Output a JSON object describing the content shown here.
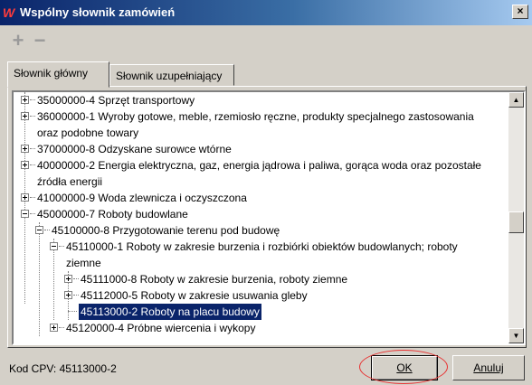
{
  "window": {
    "title": "Wspólny słownik zamówień",
    "close_glyph": "×"
  },
  "toolbar": {
    "add_glyph": "+",
    "remove_glyph": "−"
  },
  "tabs": [
    {
      "label": "Słownik główny",
      "active": true
    },
    {
      "label": "Słownik uzupełniający",
      "active": false
    }
  ],
  "tree": {
    "rows": [
      {
        "text": "35000000-4 Sprzęt transportowy"
      },
      {
        "text": "36000000-1 Wyroby gotowe, meble, rzemiosło ręczne, produkty specjalnego zastosowania"
      },
      {
        "text": "oraz podobne towary"
      },
      {
        "text": "37000000-8 Odzyskane surowce wtórne"
      },
      {
        "text": "40000000-2 Energia elektryczna, gaz, energia jądrowa i paliwa, gorąca woda oraz pozostałe"
      },
      {
        "text": "źródła energii"
      },
      {
        "text": "41000000-9 Woda zlewnicza i oczyszczona"
      },
      {
        "text": "45000000-7 Roboty budowlane"
      },
      {
        "text": "45100000-8 Przygotowanie terenu pod budowę"
      },
      {
        "text": "45110000-1 Roboty  w zakresie burzenia i rozbiórki obiektów budowlanych; roboty"
      },
      {
        "text": "ziemne"
      },
      {
        "text": "45111000-8 Roboty w zakresie burzenia, roboty ziemne"
      },
      {
        "text": "45112000-5 Roboty w zakresie usuwania gleby"
      },
      {
        "text": "45113000-2 Roboty na placu budowy"
      },
      {
        "text": "45120000-4 Próbne wiercenia i wykopy"
      }
    ]
  },
  "scrollbar": {
    "up_glyph": "▲",
    "down_glyph": "▼"
  },
  "status": {
    "cpv_label": "Kod CPV: 45113000-2"
  },
  "buttons": {
    "ok_label": "OK",
    "cancel_label": "Anuluj"
  }
}
